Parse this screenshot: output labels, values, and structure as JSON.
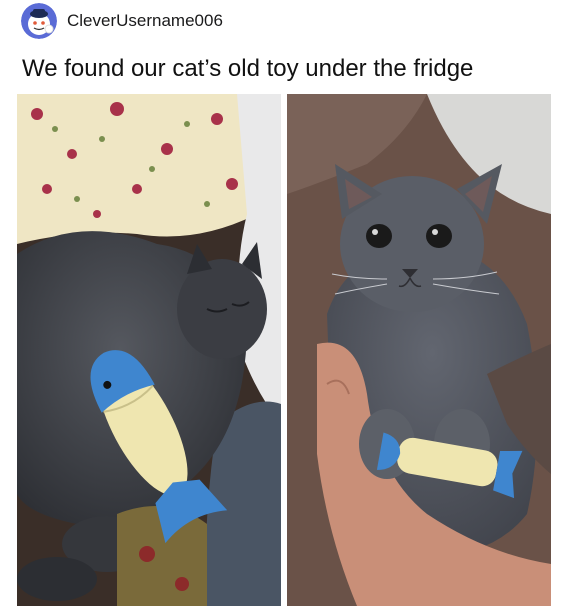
{
  "post": {
    "author": {
      "username": "CleverUsername006",
      "avatar_icon": "snoo-avatar-icon"
    },
    "title": "We found our cat’s old toy under the fridge"
  },
  "images": [
    {
      "name": "photo-left"
    },
    {
      "name": "photo-right"
    }
  ],
  "colors": {
    "background": "#ffffff",
    "text": "#1a1a1b",
    "cat_fur": "#4c4f57",
    "toy_blue": "#3f86cf",
    "toy_cream": "#efe6b0"
  }
}
